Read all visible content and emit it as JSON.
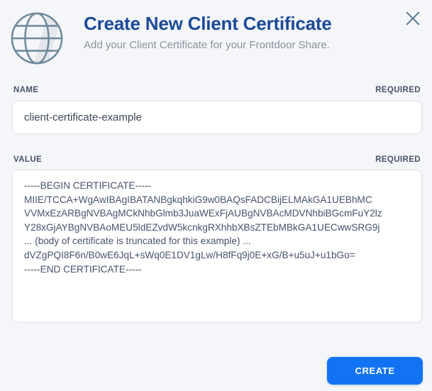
{
  "modal": {
    "title": "Create New Client Certificate",
    "subtitle": "Add your Client Certificate for your Frontdoor Share."
  },
  "icons": {
    "globe": "globe-icon",
    "close": "close-icon"
  },
  "fields": {
    "name": {
      "label": "NAME",
      "required": "REQUIRED",
      "value": "client-certificate-example"
    },
    "value": {
      "label": "VALUE",
      "required": "REQUIRED",
      "value": "-----BEGIN CERTIFICATE-----\nMIIE/TCCA+WgAwIBAgIBATANBgkqhkiG9w0BAQsFADCBijELMAkGA1UEBhMC\nVVMxEzARBgNVBAgMCkNhbGlmb3JuaWExFjAUBgNVBAcMDVNhbiBGcmFuY2lz\nY28xGjAYBgNVBAoMEU5ldEZvdW5kcnkgRXhhbXBsZTEbMBkGA1UECwwSRG9j\n... (body of certificate is truncated for this example) ...\ndVZgPQI8F6n/B0wE6JqL+sWq0E1DV1gLw/H8fFq9j0E+xG/B+u5uJ+u1bGo=\n-----END CERTIFICATE-----"
    }
  },
  "footer": {
    "create_label": "CREATE"
  },
  "colors": {
    "background": "#f4f6fa",
    "title_navy": "#1a4a96",
    "accent_blue": "#1173f4",
    "label_slate": "#49536a",
    "globe_stroke": "#6f8a9d"
  }
}
